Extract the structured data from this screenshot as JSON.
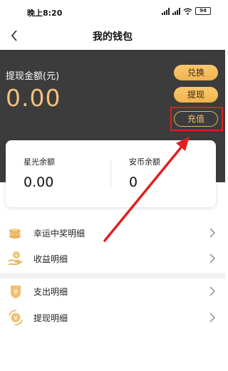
{
  "status_bar": {
    "time": "晚上8:20",
    "battery": "94"
  },
  "nav": {
    "title": "我的钱包"
  },
  "hero": {
    "label": "提现金额(元)",
    "amount": "0.00",
    "buttons": {
      "exchange": "兑换",
      "withdraw": "提现",
      "recharge": "充值"
    }
  },
  "balances": [
    {
      "label": "星光余额",
      "value": "0.00"
    },
    {
      "label": "安币余额",
      "value": "0"
    }
  ],
  "menu": [
    {
      "label": "幸运中奖明细",
      "icon": "coins-icon"
    },
    {
      "label": "收益明细",
      "icon": "hand-coin-icon"
    },
    {
      "label": "支出明细",
      "icon": "yen-shield-icon"
    },
    {
      "label": "提现明细",
      "icon": "yen-cycle-icon"
    }
  ],
  "colors": {
    "accent": "#f5c07a",
    "hero_bg": "#3c3c3c",
    "highlight": "#e02020"
  }
}
